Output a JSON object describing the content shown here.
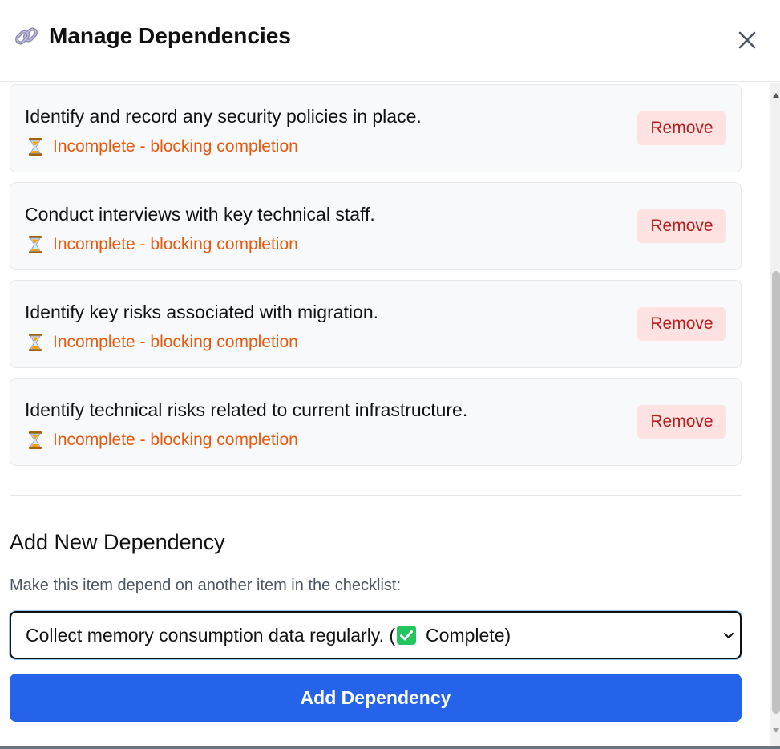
{
  "header": {
    "title": "Manage Dependencies",
    "title_icon": "link-icon",
    "close_icon": "close-icon"
  },
  "dependencies": [
    {
      "title": "Identify and record any security policies in place.",
      "status_icon": "hourglass-icon",
      "status": "Incomplete - blocking completion",
      "remove_label": "Remove"
    },
    {
      "title": "Conduct interviews with key technical staff.",
      "status_icon": "hourglass-icon",
      "status": "Incomplete - blocking completion",
      "remove_label": "Remove"
    },
    {
      "title": "Identify key risks associated with migration.",
      "status_icon": "hourglass-icon",
      "status": "Incomplete - blocking completion",
      "remove_label": "Remove"
    },
    {
      "title": "Identify technical risks related to current infrastructure.",
      "status_icon": "hourglass-icon",
      "status": "Incomplete - blocking completion",
      "remove_label": "Remove"
    }
  ],
  "add_section": {
    "title": "Add New Dependency",
    "help_text": "Make this item depend on another item in the checklist:",
    "select": {
      "selected_prefix": "Collect memory consumption data regularly. (",
      "selected_icon": "check-mark-icon",
      "selected_suffix": "Complete)"
    },
    "add_button_label": "Add Dependency"
  },
  "colors": {
    "status_incomplete": "#ea580c",
    "remove_bg": "#fee2e2",
    "remove_text": "#b91c1c",
    "primary": "#2563eb",
    "check_green": "#22c55e"
  }
}
